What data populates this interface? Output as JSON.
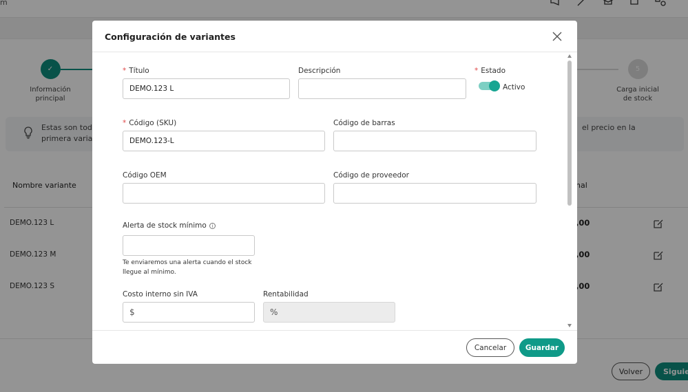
{
  "background": {
    "topbar_text": "m",
    "steps": [
      {
        "marker": "✓",
        "label": "Información principal"
      },
      {
        "marker": "5",
        "label": "Carga inicial de stock"
      }
    ],
    "info": {
      "line1": "Estas son toda",
      "line2": "primera varian",
      "line3": "el precio en la"
    },
    "columns": {
      "name": "Nombre variante",
      "price": "nal"
    },
    "rows": [
      {
        "name": "DEMO.123 L",
        "price": ",00"
      },
      {
        "name": "DEMO.123 M",
        "price": ",00"
      },
      {
        "name": "DEMO.123 S",
        "price": ",00"
      }
    ],
    "footer": {
      "back_label": "Volver",
      "next_label": "Siguien"
    }
  },
  "modal": {
    "title": "Configuración de variantes",
    "fields": {
      "titulo": {
        "label": "Título",
        "required_mark": "*",
        "value": "DEMO.123 L"
      },
      "descripcion": {
        "label": "Descripción",
        "value": ""
      },
      "estado": {
        "label": "Estado",
        "required_mark": "*",
        "toggle_label": "Activo",
        "on": true
      },
      "codigo_sku": {
        "label": "Código (SKU)",
        "required_mark": "*",
        "value": "DEMO.123-L"
      },
      "codigo_barras": {
        "label": "Código de barras",
        "value": ""
      },
      "codigo_oem": {
        "label": "Código OEM",
        "value": ""
      },
      "codigo_proveedor": {
        "label": "Código de proveedor",
        "value": ""
      },
      "alerta_stock": {
        "label": "Alerta de stock mínimo",
        "info_glyph": "i",
        "value": "",
        "hint_line1": "Te enviaremos una alerta cuando el stock",
        "hint_line2": "llegue al mínimo."
      },
      "costo_interno": {
        "label": "Costo interno sin IVA",
        "prefix": "$",
        "value": ""
      },
      "rentabilidad": {
        "label": "Rentabilidad",
        "prefix": "%",
        "value": ""
      }
    },
    "buttons": {
      "cancel": "Cancelar",
      "save": "Guardar"
    }
  },
  "colors": {
    "brand": "#0f9a88",
    "required": "#e04848",
    "toggle_track": "#7dcfc3"
  }
}
